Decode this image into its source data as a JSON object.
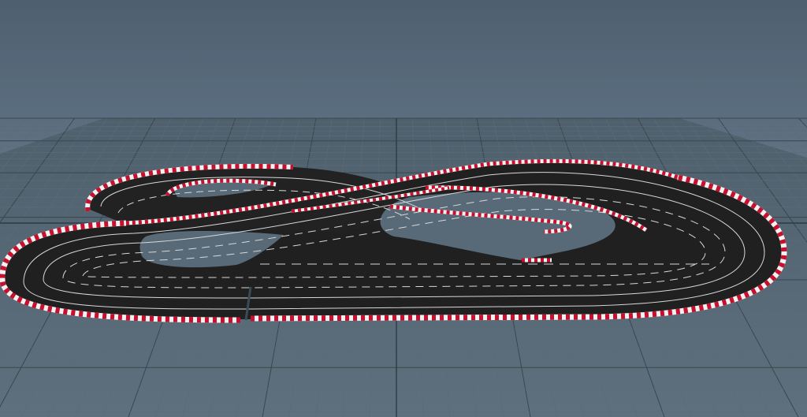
{
  "viewport": {
    "label": "",
    "camera": "perspective",
    "background_top": "#4e6070",
    "background_bottom": "#6f8496",
    "grid": {
      "visible": true,
      "major_line_color": "#3a4650",
      "minor_line_color": "#5c6b78",
      "floor_color": "#566774"
    }
  },
  "scene": {
    "object": "slot-car-race-track",
    "surface_color": "#1f1f1f",
    "curb_stripe_colors": [
      "#c8102e",
      "#f2f2f2"
    ],
    "lane_line_color": "#d8d8d8",
    "lanes_per_section": 4
  }
}
